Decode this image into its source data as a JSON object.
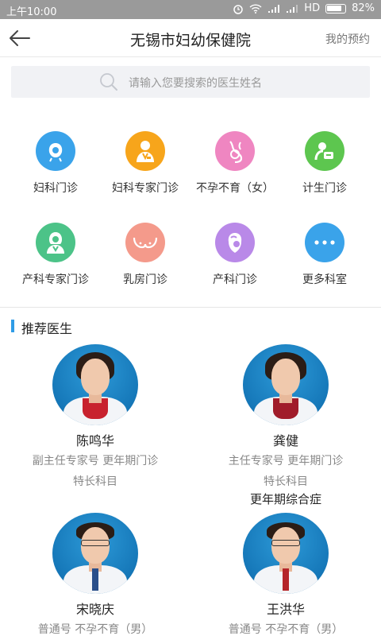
{
  "status_bar": {
    "time": "上午10:00",
    "network": "HD",
    "battery": "82%"
  },
  "header": {
    "title": "无锡市妇幼保健院",
    "my_appointment": "我的预约"
  },
  "search": {
    "placeholder": "请输入您要搜索的医生姓名"
  },
  "departments": [
    {
      "label": "妇科门诊",
      "icon": "woman-head-icon",
      "color": "#3aa3ea"
    },
    {
      "label": "妇科专家门诊",
      "icon": "doctor-icon",
      "color": "#f7a51b"
    },
    {
      "label": "不孕不育（女）",
      "icon": "pregnancy-icon",
      "color": "#ef86c1"
    },
    {
      "label": "计生门诊",
      "icon": "family-planning-icon",
      "color": "#5dc64f"
    },
    {
      "label": "产科专家门诊",
      "icon": "female-doctor-icon",
      "color": "#4cc388"
    },
    {
      "label": "乳房门诊",
      "icon": "breast-icon",
      "color": "#f49a8b"
    },
    {
      "label": "产科门诊",
      "icon": "mother-baby-icon",
      "color": "#b989e8"
    },
    {
      "label": "更多科室",
      "icon": "more-icon",
      "color": "#3aa3ea"
    }
  ],
  "recommended": {
    "title": "推荐医生",
    "specialty_label": "特长科目",
    "doctors": [
      {
        "name": "陈鸣华",
        "info": "副主任专家号  更年期门诊",
        "specialty": ""
      },
      {
        "name": "龚健",
        "info": "主任专家号  更年期门诊",
        "specialty": "更年期综合症"
      },
      {
        "name": "宋晓庆",
        "info": "普通号  不孕不育（男）",
        "specialty": ""
      },
      {
        "name": "王洪华",
        "info": "普通号  不孕不育（男）",
        "specialty": ""
      }
    ]
  }
}
